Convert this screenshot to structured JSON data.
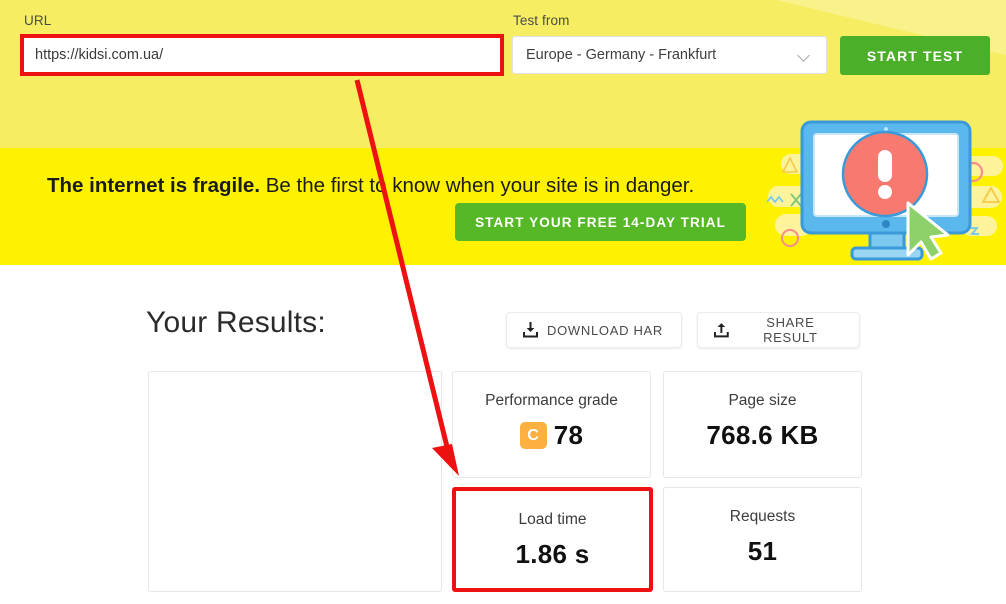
{
  "test_bar": {
    "url_label": "URL",
    "url_value": "https://kidsi.com.ua/",
    "url_placeholder": "Enter a URL",
    "location_label": "Test from",
    "location_value": "Europe - Germany - Frankfurt",
    "start_button": "START TEST",
    "chevron_icon": "chevron-down-icon"
  },
  "promo": {
    "headline_strong": "The internet is fragile.",
    "headline_rest": " Be the first to know when your site is in danger.",
    "cta_button": "START YOUR FREE 14-DAY TRIAL",
    "illustration_icon": "monitor-alert-icon"
  },
  "results": {
    "title": "Your Results:",
    "download_button": "DOWNLOAD HAR",
    "download_icon": "download-icon",
    "share_button": "SHARE RESULT",
    "share_icon": "upload-icon",
    "cards": [
      {
        "label": "Performance grade",
        "value": "78",
        "grade": "C"
      },
      {
        "label": "Page size",
        "value": "768.6 KB"
      },
      {
        "label": "Load time",
        "value": "1.86 s"
      },
      {
        "label": "Requests",
        "value": "51"
      }
    ]
  },
  "colors": {
    "bar_yellow": "#f6ed62",
    "banner_yellow": "#fff200",
    "green_button": "#4caf29",
    "green_cta": "#57b827",
    "annotation_red": "#ee1111",
    "grade_orange": "#fbb040"
  }
}
